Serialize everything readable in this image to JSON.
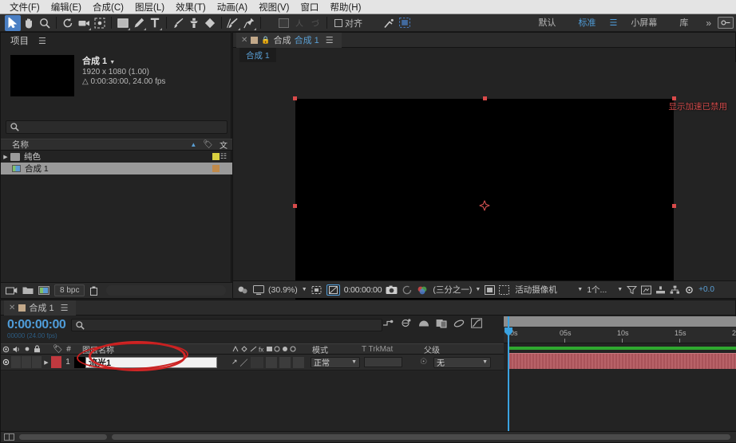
{
  "menubar": {
    "items": [
      {
        "label": "文件(F)",
        "name": "menu-file"
      },
      {
        "label": "编辑(E)",
        "name": "menu-edit"
      },
      {
        "label": "合成(C)",
        "name": "menu-composition"
      },
      {
        "label": "图层(L)",
        "name": "menu-layer"
      },
      {
        "label": "效果(T)",
        "name": "menu-effect"
      },
      {
        "label": "动画(A)",
        "name": "menu-animation"
      },
      {
        "label": "视图(V)",
        "name": "menu-view"
      },
      {
        "label": "窗口",
        "name": "menu-window"
      },
      {
        "label": "帮助(H)",
        "name": "menu-help"
      }
    ]
  },
  "toolbar": {
    "align_label": "对齐",
    "workspaces": [
      {
        "label": "默认",
        "active": false
      },
      {
        "label": "标准",
        "active": true
      },
      {
        "label": "小屏幕",
        "active": false
      },
      {
        "label": "库",
        "active": false
      }
    ],
    "more_label": "»"
  },
  "project": {
    "title": "项目",
    "search_placeholder": "",
    "item": {
      "name": "合成 1",
      "resolution": "1920 x 1080 (1.00)",
      "duration": "0:00:30:00, 24.00 fps"
    },
    "column_name": "名称",
    "column_extra": "文",
    "rows": [
      {
        "label": "纯色",
        "type": "folder",
        "swatch": "#d8d040",
        "selected": false
      },
      {
        "label": "合成 1",
        "type": "comp",
        "swatch": "#c08a4a",
        "selected": true
      }
    ],
    "bitdepth": "8 bpc"
  },
  "composition": {
    "tab_label": "合成",
    "tab_name": "合成 1",
    "breadcrumb": "合成 1",
    "warning": "显示加速已禁用",
    "zoom": "(30.9%)",
    "timecode": "0:00:00:00",
    "resolution": "(三分之一)",
    "camera": "活动摄像机",
    "views": "1个...",
    "exposure": "+0.0"
  },
  "timeline": {
    "tab_name": "合成 1",
    "timecode": "0:00:00:00",
    "timecode_sub": "00000 (24.00 fps)",
    "search_placeholder": "",
    "columns": {
      "layer_name": "图层名称",
      "mode": "模式",
      "trkmat": "TrkMat",
      "parent": "父级",
      "hash": "#"
    },
    "layer": {
      "index": "1",
      "name_value": "流光1",
      "mode_value": "正常",
      "parent_value": "无",
      "color": "#c0393f"
    },
    "ruler_ticks": [
      {
        "label": "0s",
        "pos": 2
      },
      {
        "label": "05s",
        "pos": 24
      },
      {
        "label": "10s",
        "pos": 49
      },
      {
        "label": "15s",
        "pos": 73
      },
      {
        "label": "2",
        "pos": 98
      }
    ]
  },
  "colors": {
    "accent_blue": "#4f9cd8",
    "warning_red": "#d04a4a",
    "layer_red": "#b4585f",
    "workarea_green": "#2fa82f",
    "annotation_red": "#d12626"
  }
}
